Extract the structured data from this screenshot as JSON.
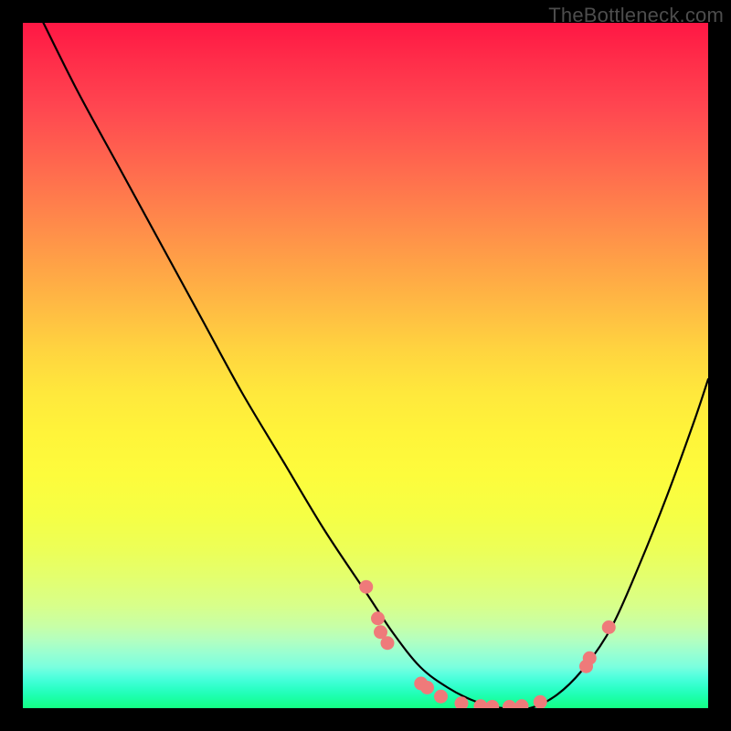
{
  "watermark": "TheBottleneck.com",
  "chart_data": {
    "type": "line",
    "title": "",
    "xlabel": "",
    "ylabel": "",
    "xlim": [
      0,
      100
    ],
    "ylim": [
      0,
      100
    ],
    "grid": false,
    "legend": false,
    "series": [
      {
        "name": "bottleneck-curve",
        "x": [
          3,
          8,
          14,
          20,
          26,
          32,
          38,
          44,
          50,
          54,
          58,
          62,
          66,
          70,
          74,
          78,
          82,
          86,
          90,
          94,
          98,
          100
        ],
        "y": [
          100,
          90,
          79,
          68,
          57,
          46,
          36,
          26,
          17,
          11,
          6,
          3,
          1,
          0,
          0,
          2,
          6,
          12,
          21,
          31,
          42,
          48
        ]
      }
    ],
    "dots": {
      "name": "highlighted-points",
      "points": [
        {
          "x": 50.1,
          "y": 17.7
        },
        {
          "x": 51.8,
          "y": 13.1
        },
        {
          "x": 52.2,
          "y": 11.1
        },
        {
          "x": 53.2,
          "y": 9.5
        },
        {
          "x": 58.1,
          "y": 3.6
        },
        {
          "x": 59.0,
          "y": 3.0
        },
        {
          "x": 61.0,
          "y": 1.7
        },
        {
          "x": 64.0,
          "y": 0.7
        },
        {
          "x": 66.8,
          "y": 0.3
        },
        {
          "x": 68.5,
          "y": 0.2
        },
        {
          "x": 71.0,
          "y": 0.2
        },
        {
          "x": 72.8,
          "y": 0.3
        },
        {
          "x": 75.5,
          "y": 0.9
        },
        {
          "x": 82.2,
          "y": 6.1
        },
        {
          "x": 82.7,
          "y": 7.3
        },
        {
          "x": 85.5,
          "y": 11.8
        }
      ]
    },
    "background_gradient": {
      "top": "#ff1744",
      "mid": "#ffe83c",
      "bottom": "#14ff84"
    }
  }
}
